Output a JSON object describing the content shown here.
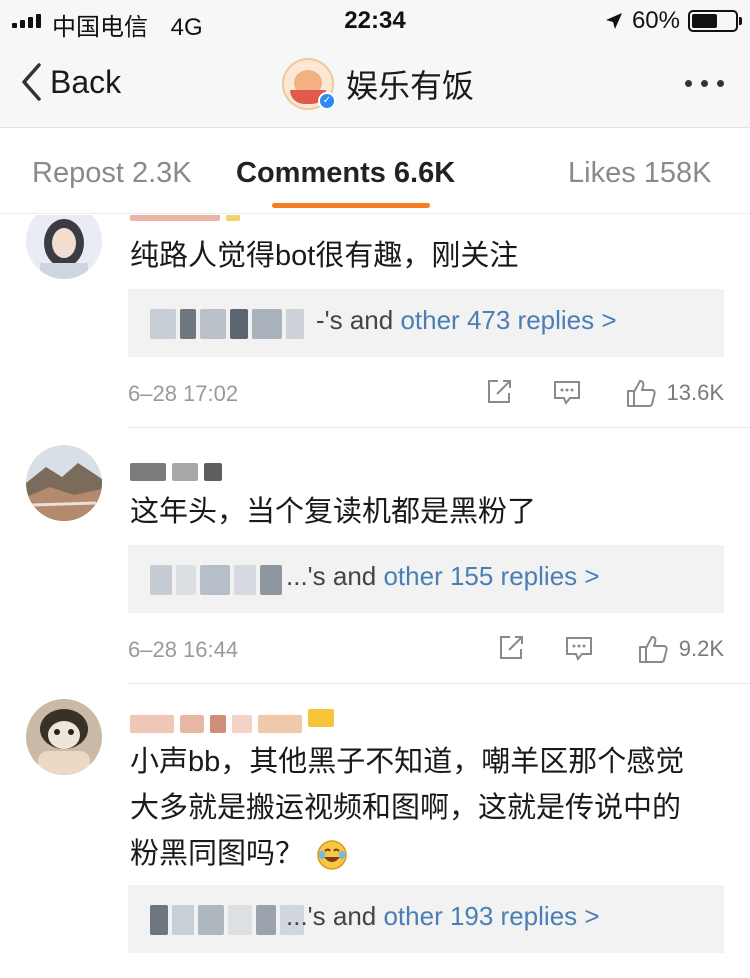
{
  "status_bar": {
    "carrier": "中国电信",
    "network": "4G",
    "time": "22:34",
    "battery_text": "60%",
    "battery_level": 0.6
  },
  "nav": {
    "back_label": "Back",
    "title": "娱乐有饭",
    "verified_icon": "verified-badge-icon",
    "more_icon": "more-dots-icon"
  },
  "tabs": {
    "repost": "Repost 2.3K",
    "comments": "Comments 6.6K",
    "likes": "Likes 158K",
    "active": "comments",
    "accent_color": "#f77d24"
  },
  "comments": [
    {
      "text": "纯路人觉得bot很有趣，刚关注",
      "reply_owner": "-'s and ",
      "reply_link": "other 473 replies >",
      "time": "6–28 17:02",
      "likes": "13.6K"
    },
    {
      "text": "这年头，当个复读机都是黑粉了",
      "reply_owner": "...'s and ",
      "reply_link": "other 155 replies >",
      "time": "6–28 16:44",
      "likes": "9.2K"
    },
    {
      "text_line1": "小声bb，其他黑子不知道，嘲羊区那个感觉",
      "text_line2": "大多就是搬运视频和图啊，这就是传说中的",
      "text_line3": "粉黑同图吗？",
      "reply_owner": "...'s and ",
      "reply_link": "other 193 replies >"
    }
  ],
  "colors": {
    "link": "#4a7fb5",
    "meta": "#9a9a9a"
  }
}
